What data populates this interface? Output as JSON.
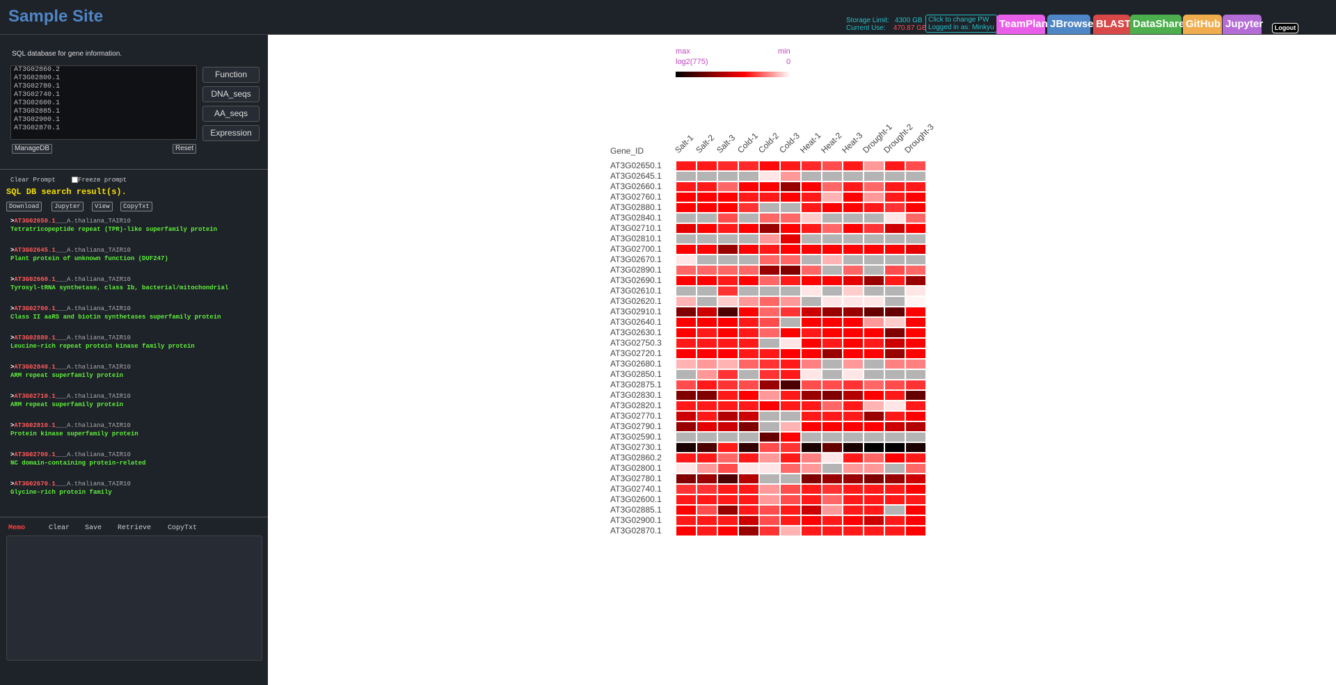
{
  "header": {
    "site_title": "Sample Site",
    "storage_limit_label": "Storage Limit:",
    "storage_limit_value": "4300 GB",
    "current_use_label": "Current Use:",
    "current_use_value": "470.87 GB",
    "pw_line1": "Click to change PW",
    "pw_line2": "Logged in as: Minkyu",
    "nav": [
      {
        "label": "TeamPlan",
        "color": "#e85ee8"
      },
      {
        "label": "JBrowse",
        "color": "#4f86c6"
      },
      {
        "label": "BLAST",
        "color": "#d94848"
      },
      {
        "label": "DataShare",
        "color": "#4cae4c"
      },
      {
        "label": "GitHub",
        "color": "#f0ad4e"
      },
      {
        "label": "Jupyter",
        "color": "#b46cd6"
      }
    ],
    "logout": "Logout"
  },
  "left": {
    "db_label": "SQL database for gene information.",
    "gene_text": "AT3G02860.2\nAT3G02800.1\nAT3G02780.1\nAT3G02740.1\nAT3G02600.1\nAT3G02885.1\nAT3G02900.1\nAT3G02870.1",
    "buttons": {
      "function": "Function",
      "dna": "DNA_seqs",
      "aa": "AA_seqs",
      "expression": "Expression"
    },
    "managedb": "ManageDB",
    "reset": "Reset",
    "clear_prompt": "Clear Prompt",
    "freeze_prompt": "Freeze prompt",
    "results_title": "SQL DB search result(s).",
    "result_buttons": {
      "download": "Download",
      "jupyter": "Jupyter",
      "view": "View",
      "copytxt": "CopyTxt"
    },
    "results": [
      {
        "id": "AT3G02650.1",
        "species": "___A.thaliana_TAIR10",
        "desc": "Tetratricopeptide repeat (TPR)-like superfamily protein"
      },
      {
        "id": "AT3G02645.1",
        "species": "___A.thaliana_TAIR10",
        "desc": "Plant protein of unknown function (DUF247)"
      },
      {
        "id": "AT3G02660.1",
        "species": "___A.thaliana_TAIR10",
        "desc": "Tyrosyl-tRNA synthetase, class Ib, bacterial/mitochondrial"
      },
      {
        "id": "AT3G02760.1",
        "species": "___A.thaliana_TAIR10",
        "desc": "Class II aaRS and biotin synthetases superfamily protein"
      },
      {
        "id": "AT3G02880.1",
        "species": "___A.thaliana_TAIR10",
        "desc": "Leucine-rich repeat protein kinase family protein"
      },
      {
        "id": "AT3G02840.1",
        "species": "___A.thaliana_TAIR10",
        "desc": "ARM repeat superfamily protein"
      },
      {
        "id": "AT3G02710.1",
        "species": "___A.thaliana_TAIR10",
        "desc": "ARM repeat superfamily protein"
      },
      {
        "id": "AT3G02810.1",
        "species": "___A.thaliana_TAIR10",
        "desc": "Protein kinase superfamily protein"
      },
      {
        "id": "AT3G02700.1",
        "species": "___A.thaliana_TAIR10",
        "desc": "NC domain-containing protein-related"
      },
      {
        "id": "AT3G02670.1",
        "species": "___A.thaliana_TAIR10",
        "desc": "Glycine-rich protein family"
      }
    ],
    "memo": {
      "label": "Memo",
      "clear": "Clear",
      "save": "Save",
      "retrieve": "Retrieve",
      "copytxt": "CopyTxt"
    }
  },
  "chart_data": {
    "type": "heatmap",
    "legend": {
      "max_label": "max",
      "max_value": "log2(775)",
      "min_label": "min",
      "min_value": "0"
    },
    "row_header": "Gene_ID",
    "columns": [
      "Salt-1",
      "Salt-2",
      "Salt-3",
      "Cold-1",
      "Cold-2",
      "Cold-3",
      "Heat-1",
      "Heat-2",
      "Heat-3",
      "Drought-1",
      "Drought-2",
      "Drought-3"
    ],
    "rows": [
      "AT3G02650.1",
      "AT3G02645.1",
      "AT3G02660.1",
      "AT3G02760.1",
      "AT3G02880.1",
      "AT3G02840.1",
      "AT3G02710.1",
      "AT3G02810.1",
      "AT3G02700.1",
      "AT3G02670.1",
      "AT3G02890.1",
      "AT3G02690.1",
      "AT3G02610.1",
      "AT3G02620.1",
      "AT3G02910.1",
      "AT3G02640.1",
      "AT3G02630.1",
      "AT3G02750.3",
      "AT3G02720.1",
      "AT3G02680.1",
      "AT3G02850.1",
      "AT3G02875.1",
      "AT3G02830.1",
      "AT3G02820.1",
      "AT3G02770.1",
      "AT3G02790.1",
      "AT3G02590.1",
      "AT3G02730.1",
      "AT3G02860.2",
      "AT3G02800.1",
      "AT3G02780.1",
      "AT3G02740.1",
      "AT3G02600.1",
      "AT3G02885.1",
      "AT3G02900.1",
      "AT3G02870.1"
    ],
    "missing_color": "#b4b4b4",
    "values": [
      [
        0.45,
        0.45,
        0.42,
        0.42,
        0.48,
        0.45,
        0.42,
        0.35,
        0.45,
        0.2,
        0.45,
        0.35
      ],
      [
        -1,
        -1,
        -1,
        -1,
        0.05,
        0.2,
        -1,
        -1,
        -1,
        -1,
        -1,
        -1
      ],
      [
        0.45,
        0.45,
        0.3,
        0.5,
        0.5,
        0.7,
        0.5,
        0.3,
        0.45,
        0.3,
        0.45,
        0.45
      ],
      [
        0.5,
        0.5,
        0.5,
        0.45,
        0.45,
        0.5,
        0.45,
        0.15,
        0.5,
        0.2,
        0.45,
        0.5
      ],
      [
        0.5,
        0.5,
        0.5,
        0.4,
        -1,
        -1,
        0.45,
        0.5,
        0.5,
        0.45,
        0.4,
        0.5
      ],
      [
        -1,
        -1,
        0.35,
        -1,
        0.3,
        0.3,
        0.1,
        -1,
        -1,
        -1,
        0.05,
        0.3
      ],
      [
        0.55,
        0.5,
        0.45,
        0.5,
        0.7,
        0.5,
        0.45,
        0.3,
        0.5,
        0.4,
        0.6,
        0.5
      ],
      [
        -1,
        -1,
        -1,
        -1,
        0.2,
        0.55,
        -1,
        -1,
        -1,
        -1,
        -1,
        -1
      ],
      [
        0.5,
        0.5,
        0.7,
        0.5,
        0.45,
        0.5,
        0.5,
        0.5,
        0.5,
        0.5,
        0.5,
        0.55
      ],
      [
        0.05,
        -1,
        -1,
        -1,
        0.3,
        0.3,
        -1,
        0.15,
        -1,
        -1,
        -1,
        -1
      ],
      [
        0.3,
        0.3,
        0.3,
        0.3,
        0.7,
        0.75,
        0.3,
        -1,
        0.3,
        -1,
        0.35,
        0.3
      ],
      [
        0.5,
        0.5,
        0.45,
        0.5,
        0.3,
        0.45,
        0.5,
        0.5,
        0.55,
        0.7,
        0.45,
        0.7
      ],
      [
        -1,
        -1,
        0.4,
        -1,
        -1,
        -1,
        0.05,
        -1,
        0.1,
        -1,
        -1,
        0.05
      ],
      [
        0.15,
        -1,
        0.1,
        0.2,
        0.3,
        0.2,
        -1,
        0.05,
        0.05,
        0.05,
        -1,
        0.02
      ],
      [
        0.75,
        0.6,
        0.85,
        0.5,
        0.3,
        0.4,
        0.6,
        0.7,
        0.7,
        0.8,
        0.8,
        0.5
      ],
      [
        0.5,
        0.5,
        0.5,
        0.45,
        0.35,
        -1,
        0.5,
        0.5,
        0.5,
        0.2,
        0.1,
        0.5
      ],
      [
        0.5,
        0.45,
        0.5,
        0.45,
        0.3,
        0.5,
        0.45,
        0.5,
        0.5,
        0.5,
        0.75,
        0.5
      ],
      [
        0.45,
        0.45,
        0.45,
        0.45,
        -1,
        0.05,
        0.5,
        0.45,
        0.5,
        0.45,
        0.6,
        0.5
      ],
      [
        0.5,
        0.5,
        0.5,
        0.45,
        0.45,
        0.5,
        0.5,
        0.7,
        0.5,
        0.5,
        0.7,
        0.5
      ],
      [
        0.15,
        0.2,
        0.15,
        0.3,
        0.4,
        0.45,
        0.25,
        -1,
        0.2,
        -1,
        0.25,
        0.25
      ],
      [
        -1,
        0.2,
        0.4,
        -1,
        0.4,
        0.45,
        0.05,
        -1,
        0.05,
        -1,
        -1,
        -1
      ],
      [
        0.35,
        0.45,
        0.4,
        0.35,
        0.7,
        0.85,
        0.35,
        0.35,
        0.4,
        0.3,
        0.35,
        0.4
      ],
      [
        0.75,
        0.75,
        0.45,
        0.5,
        0.2,
        0.45,
        0.7,
        0.75,
        0.65,
        0.5,
        0.45,
        0.8
      ],
      [
        0.45,
        0.45,
        0.45,
        0.45,
        0.5,
        0.45,
        0.45,
        0.3,
        0.45,
        0.15,
        0.05,
        0.45
      ],
      [
        0.6,
        0.45,
        0.65,
        0.6,
        -1,
        -1,
        0.45,
        0.45,
        0.45,
        0.7,
        0.45,
        0.5
      ],
      [
        0.7,
        0.55,
        0.6,
        0.75,
        -1,
        0.15,
        0.5,
        0.5,
        0.5,
        0.5,
        0.6,
        0.65
      ],
      [
        -1,
        -1,
        -1,
        -1,
        0.8,
        0.5,
        -1,
        -1,
        -1,
        -1,
        -1,
        -1
      ],
      [
        0.95,
        0.85,
        0.45,
        0.9,
        0.35,
        0.4,
        0.95,
        0.8,
        0.95,
        1.0,
        1.0,
        0.95
      ],
      [
        0.45,
        0.45,
        0.3,
        0.45,
        0.2,
        0.45,
        0.25,
        0.05,
        0.45,
        0.3,
        0.5,
        0.45
      ],
      [
        0.05,
        0.2,
        0.35,
        0.05,
        0.05,
        0.3,
        0.2,
        -1,
        0.2,
        0.2,
        -1,
        0.3
      ],
      [
        0.75,
        0.7,
        0.85,
        0.65,
        -1,
        -1,
        0.75,
        0.7,
        0.7,
        0.75,
        0.7,
        0.6
      ],
      [
        0.4,
        0.4,
        0.45,
        0.45,
        0.2,
        0.35,
        0.45,
        0.4,
        0.45,
        0.45,
        0.45,
        0.5
      ],
      [
        0.45,
        0.45,
        0.45,
        0.45,
        0.2,
        0.35,
        0.45,
        0.3,
        0.45,
        0.45,
        0.45,
        0.45
      ],
      [
        0.5,
        0.35,
        0.7,
        0.45,
        0.35,
        0.45,
        0.6,
        0.2,
        0.45,
        0.45,
        -1,
        0.5
      ],
      [
        0.45,
        0.45,
        0.45,
        0.6,
        0.35,
        0.45,
        0.5,
        0.45,
        0.5,
        0.6,
        0.45,
        0.5
      ],
      [
        0.5,
        0.45,
        0.5,
        0.7,
        0.4,
        0.15,
        0.45,
        0.45,
        0.45,
        0.45,
        0.45,
        0.5
      ]
    ]
  }
}
